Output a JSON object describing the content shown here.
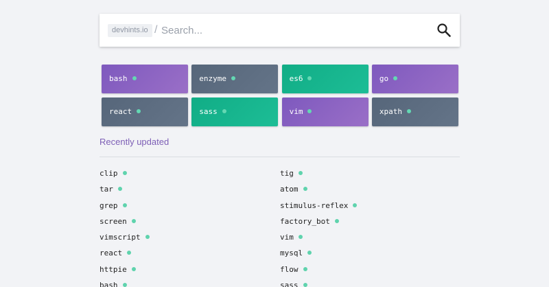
{
  "search": {
    "brand": "devhints.io",
    "separator": "/",
    "placeholder": "Search...",
    "icon": "search-icon"
  },
  "featured": [
    {
      "label": "bash",
      "color": "#8a62c2"
    },
    {
      "label": "enzyme",
      "color": "#5c6b7e"
    },
    {
      "label": "es6",
      "color": "#14b48d"
    },
    {
      "label": "go",
      "color": "#8a62c2"
    },
    {
      "label": "react",
      "color": "#5c6b7e"
    },
    {
      "label": "sass",
      "color": "#14b48d"
    },
    {
      "label": "vim",
      "color": "#8a62c2"
    },
    {
      "label": "xpath",
      "color": "#5c6b7e"
    }
  ],
  "recent": {
    "title": "Recently updated",
    "left": [
      "clip",
      "tar",
      "grep",
      "screen",
      "vimscript",
      "react",
      "httpie",
      "bash"
    ],
    "right": [
      "tig",
      "atom",
      "stimulus-reflex",
      "factory_bot",
      "vim",
      "mysql",
      "flow",
      "sass"
    ]
  },
  "colors": {
    "accent": "#7d5fb6",
    "dot": "#64d8b3",
    "background": "#f2f3f6"
  }
}
